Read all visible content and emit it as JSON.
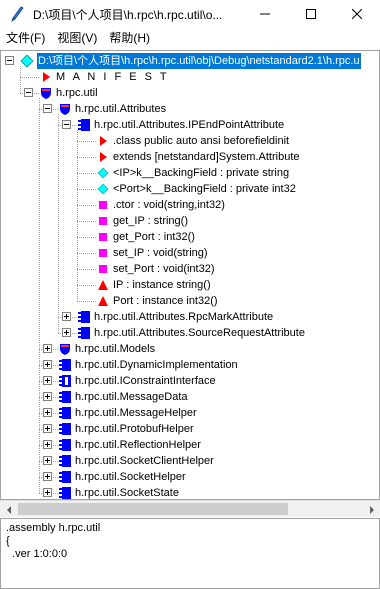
{
  "window": {
    "title": "D:\\项目\\个人项目\\h.rpc\\h.rpc.util\\o...",
    "app_icon": "ildasm-quill-icon"
  },
  "menu": {
    "file": "文件(F)",
    "view": "视图(V)",
    "help": "帮助(H)"
  },
  "tree": [
    {
      "label": "D:\\项目\\个人项目\\h.rpc\\h.rpc.util\\obj\\Debug\\netstandard2.1\\h.rpc.u",
      "icon": "assembly-diamond-icon",
      "expander": "minus",
      "selected": true
    },
    {
      "label": "M A N I F E S T",
      "icon": "manifest-triangle-icon",
      "expander": "none"
    },
    {
      "label": "h.rpc.util",
      "icon": "namespace-shield-icon",
      "expander": "minus"
    },
    {
      "label": "h.rpc.util.Attributes",
      "icon": "namespace-shield-icon",
      "expander": "minus"
    },
    {
      "label": "h.rpc.util.Attributes.IPEndPointAttribute",
      "icon": "class-icon",
      "expander": "minus"
    },
    {
      "label": ".class public auto ansi beforefieldinit",
      "icon": "info-triangle-icon",
      "expander": "none"
    },
    {
      "label": "extends [netstandard]System.Attribute",
      "icon": "info-triangle-icon",
      "expander": "none"
    },
    {
      "label": "<IP>k__BackingField : private string",
      "icon": "field-diamond-icon",
      "expander": "none"
    },
    {
      "label": "<Port>k__BackingField : private int32",
      "icon": "field-diamond-icon",
      "expander": "none"
    },
    {
      "label": ".ctor : void(string,int32)",
      "icon": "method-square-icon",
      "expander": "none"
    },
    {
      "label": "get_IP : string()",
      "icon": "method-square-icon",
      "expander": "none"
    },
    {
      "label": "get_Port : int32()",
      "icon": "method-square-icon",
      "expander": "none"
    },
    {
      "label": "set_IP : void(string)",
      "icon": "method-square-icon",
      "expander": "none"
    },
    {
      "label": "set_Port : void(int32)",
      "icon": "method-square-icon",
      "expander": "none"
    },
    {
      "label": "IP : instance string()",
      "icon": "property-triangle-icon",
      "expander": "none"
    },
    {
      "label": "Port : instance int32()",
      "icon": "property-triangle-icon",
      "expander": "none"
    },
    {
      "label": "h.rpc.util.Attributes.RpcMarkAttribute",
      "icon": "class-icon",
      "expander": "plus"
    },
    {
      "label": "h.rpc.util.Attributes.SourceRequestAttribute",
      "icon": "class-icon",
      "expander": "plus"
    },
    {
      "label": "h.rpc.util.Models",
      "icon": "namespace-shield-icon",
      "expander": "plus"
    },
    {
      "label": "h.rpc.util.DynamicImplementation",
      "icon": "class-icon",
      "expander": "plus"
    },
    {
      "label": "h.rpc.util.IConstraintInterface",
      "icon": "interface-icon",
      "expander": "plus"
    },
    {
      "label": "h.rpc.util.MessageData",
      "icon": "class-icon",
      "expander": "plus"
    },
    {
      "label": "h.rpc.util.MessageHelper",
      "icon": "class-icon",
      "expander": "plus"
    },
    {
      "label": "h.rpc.util.ProtobufHelper",
      "icon": "class-icon",
      "expander": "plus"
    },
    {
      "label": "h.rpc.util.ReflectionHelper",
      "icon": "class-icon",
      "expander": "plus"
    },
    {
      "label": "h.rpc.util.SocketClientHelper",
      "icon": "class-icon",
      "expander": "plus"
    },
    {
      "label": "h.rpc.util.SocketHelper",
      "icon": "class-icon",
      "expander": "plus"
    },
    {
      "label": "h.rpc.util.SocketState",
      "icon": "class-icon",
      "expander": "plus"
    }
  ],
  "code_pane": {
    "line1": ".assembly h.rpc.util",
    "line2": "{",
    "line3": "  .ver 1:0:0:0"
  },
  "colors": {
    "selection": "#0078d7",
    "class_blue": "#0000ff",
    "method_magenta": "#ff00ff",
    "field_cyan": "#00ffff",
    "triangle_red": "#ff0000"
  }
}
